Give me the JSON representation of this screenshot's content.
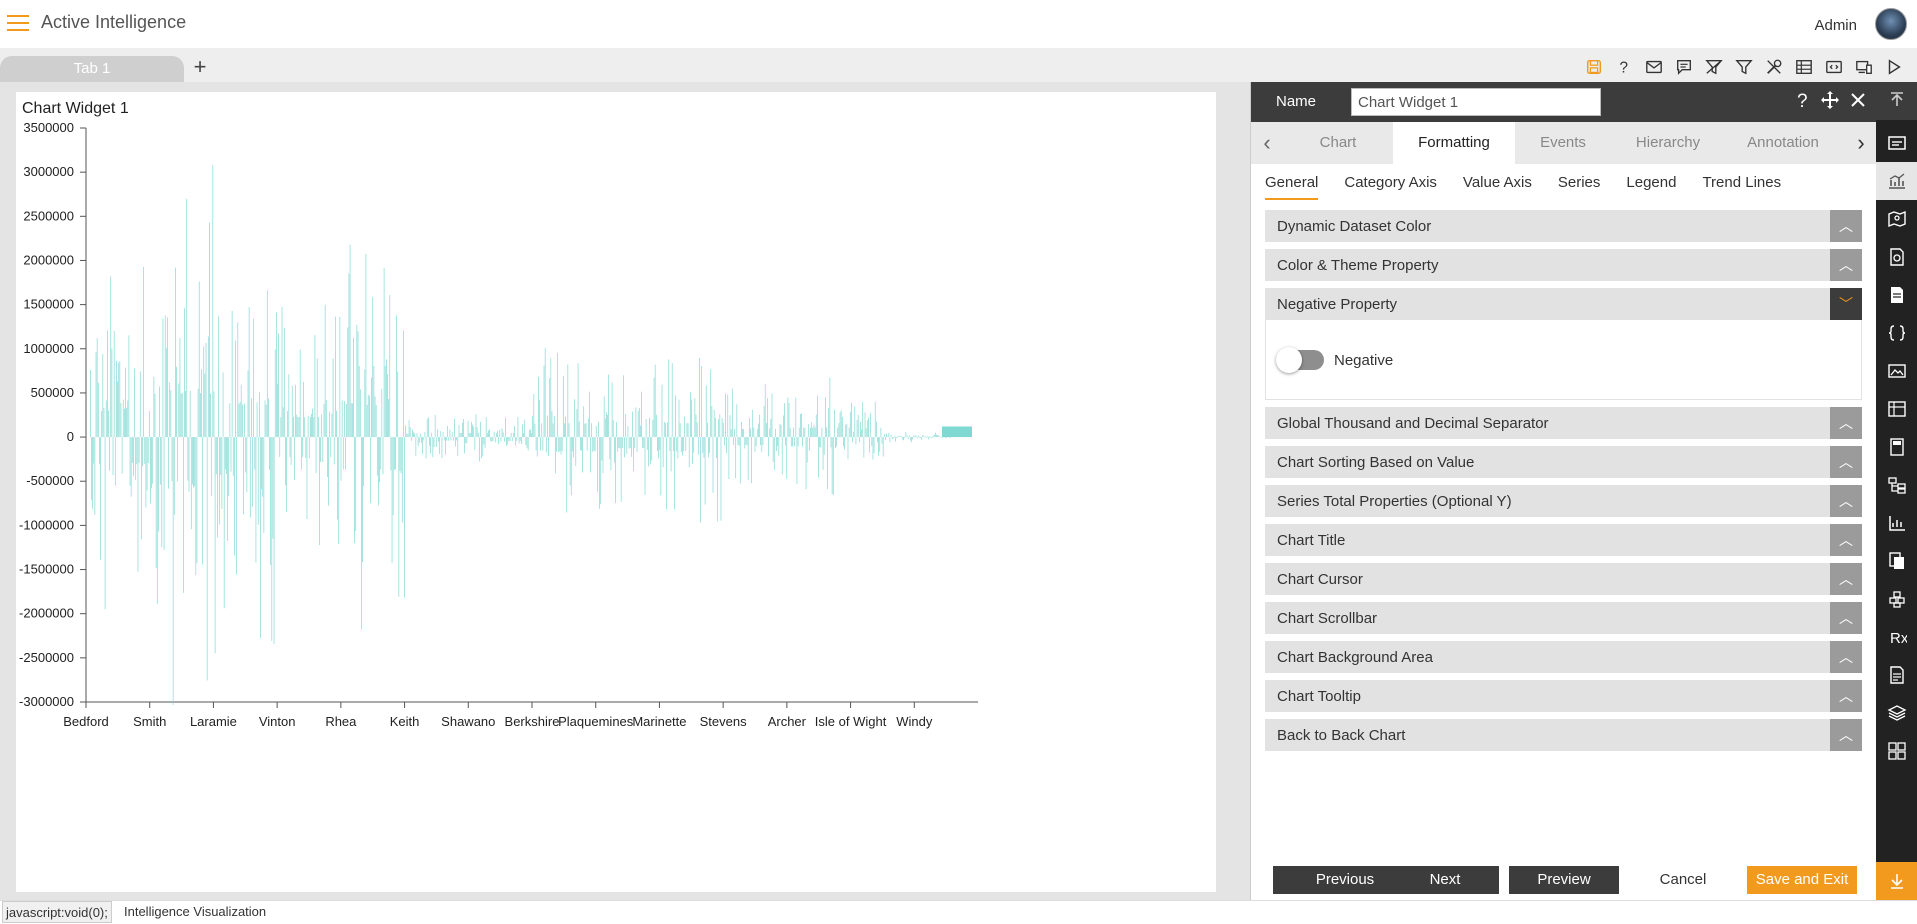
{
  "app": {
    "title": "Active Intelligence",
    "user": "Admin"
  },
  "tabs": [
    {
      "label": "Tab 1"
    }
  ],
  "tab_add_label": "+",
  "toolbar_icons": [
    "save-icon",
    "help-icon",
    "mail-icon",
    "comment-icon",
    "clear-filter-icon",
    "filter-icon",
    "tools-icon",
    "table-icon",
    "embed-icon",
    "devices-icon",
    "play-icon"
  ],
  "widget": {
    "title": "Chart Widget 1"
  },
  "chart_data": {
    "type": "bar",
    "title": "",
    "xlabel": "",
    "ylabel": "",
    "ylim": [
      -3000000,
      3500000
    ],
    "yticks": [
      3500000,
      3000000,
      2500000,
      2000000,
      1500000,
      1000000,
      500000,
      0,
      -500000,
      -1000000,
      -1500000,
      -2000000,
      -2500000,
      -3000000
    ],
    "ytick_labels": [
      "3500000",
      "3000000",
      "2500000",
      "2000000",
      "1500000",
      "1000000",
      "500000",
      "0",
      "-500000",
      "-1000000",
      "-1500000",
      "-2000000",
      "-2500000",
      "-3000000"
    ],
    "categories": [
      "Bedford",
      "Smith",
      "Laramie",
      "Vinton",
      "Rhea",
      "Keith",
      "Shawano",
      "Berkshire",
      "Plaquemines",
      "Marinette",
      "Stevens",
      "Archer",
      "Isle of Wight",
      "Windy"
    ],
    "series": [
      {
        "values": [
          -1950000,
          3280000,
          -2450000,
          1500000,
          -2420000,
          250000,
          300000,
          1010000,
          820000,
          -1050000,
          600000,
          -700000,
          400000,
          350000
        ]
      }
    ],
    "color": "#7fd8d2",
    "grid": false,
    "legend": "none"
  },
  "panel": {
    "name_label": "Name",
    "name_value": "Chart Widget 1",
    "main_tabs": [
      "Chart",
      "Formatting",
      "Events",
      "Hierarchy",
      "Annotation"
    ],
    "active_main_tab": "Formatting",
    "sub_tabs": [
      "General",
      "Category Axis",
      "Value Axis",
      "Series",
      "Legend",
      "Trend Lines"
    ],
    "active_sub_tab": "General",
    "sections": [
      {
        "label": "Dynamic Dataset Color",
        "open": false
      },
      {
        "label": "Color & Theme Property",
        "open": false
      },
      {
        "label": "Negative Property",
        "open": true,
        "toggle_label": "Negative",
        "toggle_on": false
      },
      {
        "label": "Global Thousand and Decimal Separator",
        "open": false
      },
      {
        "label": "Chart Sorting Based on Value",
        "open": false
      },
      {
        "label": "Series Total Properties (Optional Y)",
        "open": false
      },
      {
        "label": "Chart Title",
        "open": false
      },
      {
        "label": "Chart Cursor",
        "open": false
      },
      {
        "label": "Chart Scrollbar",
        "open": false
      },
      {
        "label": "Chart Background Area",
        "open": false
      },
      {
        "label": "Chart Tooltip",
        "open": false
      },
      {
        "label": "Back to Back Chart",
        "open": false
      }
    ],
    "buttons": {
      "previous": "Previous",
      "next": "Next",
      "preview": "Preview",
      "cancel": "Cancel",
      "save_exit": "Save and Exit"
    }
  },
  "status": {
    "link": "javascript:void(0);",
    "app": "Intelligence Visualization"
  },
  "colors": {
    "accent": "#f29a1e",
    "dark": "#3c3c3c",
    "bar": "#7fd8d2"
  }
}
